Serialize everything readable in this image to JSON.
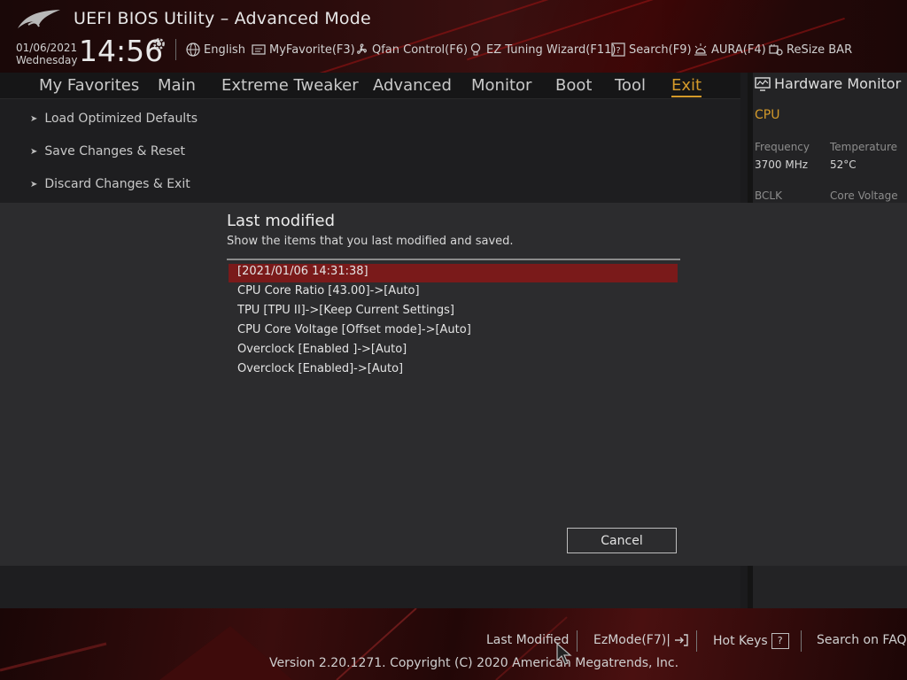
{
  "header": {
    "app_title": "UEFI BIOS Utility – Advanced Mode",
    "date": "01/06/2021",
    "weekday": "Wednesday",
    "time": "14:56",
    "toolbar": [
      {
        "label": "English",
        "icon": "globe-icon"
      },
      {
        "label": "MyFavorite(F3)",
        "icon": "favorite-icon"
      },
      {
        "label": "Qfan Control(F6)",
        "icon": "fan-icon"
      },
      {
        "label": "EZ Tuning Wizard(F11)",
        "icon": "lightbulb-icon"
      },
      {
        "label": "Search(F9)",
        "icon": "search-help-icon"
      },
      {
        "label": "AURA(F4)",
        "icon": "aura-light-icon"
      },
      {
        "label": "ReSize BAR",
        "icon": "resize-bar-icon"
      }
    ]
  },
  "nav": {
    "tabs": [
      {
        "label": "My Favorites"
      },
      {
        "label": "Main"
      },
      {
        "label": "Extreme Tweaker"
      },
      {
        "label": "Advanced"
      },
      {
        "label": "Monitor"
      },
      {
        "label": "Boot"
      },
      {
        "label": "Tool"
      },
      {
        "label": "Exit"
      }
    ],
    "active_tab": "Exit"
  },
  "exit_menu": {
    "items": [
      {
        "label": "Load Optimized Defaults"
      },
      {
        "label": "Save Changes & Reset"
      },
      {
        "label": "Discard Changes & Exit"
      }
    ]
  },
  "hardware_monitor": {
    "title": "Hardware Monitor",
    "section": "CPU",
    "frequency_label": "Frequency",
    "frequency_value": "3700 MHz",
    "temperature_label": "Temperature",
    "temperature_value": "52°C",
    "bclk_label": "BCLK",
    "core_voltage_label": "Core Voltage"
  },
  "dialog": {
    "title": "Last modified",
    "subtitle": "Show the items that you last modified and saved.",
    "entries": [
      "[2021/01/06 14:31:38]",
      "CPU Core Ratio [43.00]->[Auto]",
      "TPU [TPU II]->[Keep Current Settings]",
      "CPU Core Voltage [Offset mode]->[Auto]",
      "Overclock [Enabled ]->[Auto]",
      "Overclock [Enabled]->[Auto]"
    ],
    "selected_index": 0,
    "cancel_label": "Cancel"
  },
  "footer": {
    "last_modified_label": "Last Modified",
    "ezmode_label": "EzMode(F7)|",
    "hotkeys_label": "Hot Keys",
    "hotkeys_key": "?",
    "faq_label": "Search on FAQ",
    "copyright": "Version 2.20.1271. Copyright (C) 2020 American Megatrends, Inc."
  },
  "colors": {
    "accent": "#d49a2a",
    "selection": "#7a1a1a",
    "brand_red": "#a01414"
  }
}
